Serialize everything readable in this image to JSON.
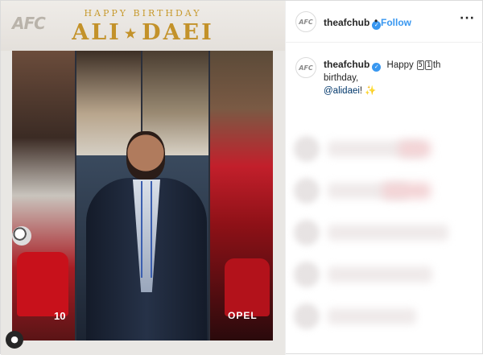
{
  "post_image": {
    "top_text": "HAPPY BIRTHDAY",
    "name_left": "ALI",
    "name_right": "DAEI",
    "name_separator": "★",
    "logo_text": "AFC",
    "jersey_number": "10",
    "sponsor_text": "OPEL",
    "badge_icon": "user-tag-icon"
  },
  "header": {
    "username": "theafchub",
    "verified_icon": "verified-badge-icon",
    "separator": "•",
    "follow_label": "Follow",
    "more_label": "···"
  },
  "caption": {
    "username": "theafchub",
    "text_before": "Happy",
    "digit_1": "5",
    "digit_2": "1",
    "text_after": "th birthday,",
    "mention": "@alidaei",
    "text_end": "!",
    "sparkle": "✨"
  },
  "colors": {
    "accent_gold": "#c3922a",
    "link_blue": "#3897f0",
    "mention_blue": "#00376b",
    "text": "#262626"
  }
}
